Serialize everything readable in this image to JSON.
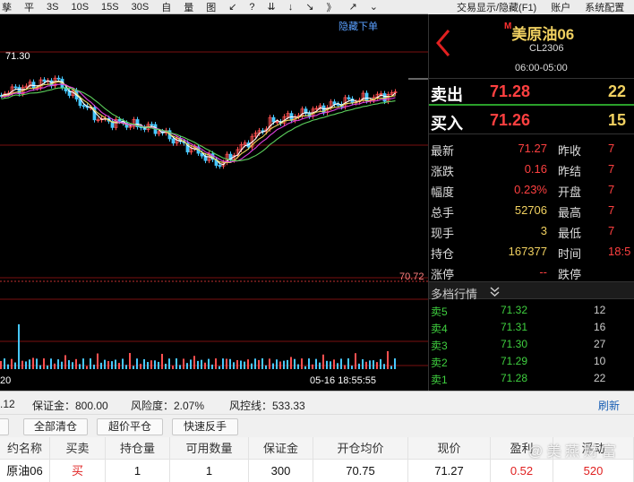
{
  "toolbar": {
    "items": [
      "孳",
      "平",
      "3S",
      "10S",
      "15S",
      "30S",
      "自",
      "量",
      "图",
      "↙",
      "?",
      "⇊",
      "↓",
      "↘",
      "》",
      "↗",
      "⌄"
    ]
  },
  "topright": {
    "items": [
      "交易显示/隐藏(F1)",
      "账户",
      "系统配置"
    ]
  },
  "chart": {
    "hide_order": "隐藏下单",
    "price_high": "71.30",
    "price_low": "70.72",
    "time_left": "20",
    "timestamp": "05-16 18:55:55",
    "colors": {
      "candle_up": "#ff5050",
      "candle_down": "#47c8ff",
      "ma_white": "#ffffff",
      "ma_yellow": "#e6d45a",
      "ma_magenta": "#e040e0",
      "ma_green": "#5cd05c",
      "grid_red": "#7a1010"
    }
  },
  "quote": {
    "name": "美原油06",
    "badge": "M",
    "code": "CL2306",
    "session": "06:00-05:00",
    "sell_label": "卖出",
    "sell_price": "71.28",
    "sell_qty": "22",
    "buy_label": "买入",
    "buy_price": "71.26",
    "buy_qty": "15",
    "stats": [
      {
        "l": "最新",
        "v": "71.27",
        "l2": "昨收",
        "v2": "7"
      },
      {
        "l": "涨跌",
        "v": "0.16",
        "l2": "昨结",
        "v2": "7"
      },
      {
        "l": "幅度",
        "v": "0.23%",
        "l2": "开盘",
        "v2": "7"
      },
      {
        "l": "总手",
        "v": "52706",
        "l2": "最高",
        "v2": "7"
      },
      {
        "l": "现手",
        "v": "3",
        "l2": "最低",
        "v2": "7"
      },
      {
        "l": "持仓",
        "v": "167377",
        "l2": "时间",
        "v2": "18:5"
      },
      {
        "l": "涨停",
        "v": "--",
        "l2": "跌停",
        "v2": ""
      }
    ],
    "depth_title": "多档行情",
    "depth_icon": "chevron-double-down",
    "depth": [
      {
        "l": "卖5",
        "p": "71.32",
        "q": "12"
      },
      {
        "l": "卖4",
        "p": "71.31",
        "q": "16"
      },
      {
        "l": "卖3",
        "p": "71.30",
        "q": "27"
      },
      {
        "l": "卖2",
        "p": "71.29",
        "q": "10"
      },
      {
        "l": "卖1",
        "p": "71.28",
        "q": "22"
      }
    ]
  },
  "status": {
    "lead": ".12",
    "margin": "保证金：800.00",
    "risk": "风险度：2.07%",
    "risk_line": "风控线：533.33",
    "refresh": "刷新"
  },
  "buttons": {
    "b0": "",
    "b1": "全部清仓",
    "b2": "超价平仓",
    "b3": "快速反手"
  },
  "table": {
    "headers": [
      "约名称",
      "买卖",
      "持仓量",
      "可用数量",
      "保证金",
      "开仓均价",
      "现价",
      "盈利",
      "浮动"
    ],
    "row": [
      "原油06",
      "买",
      "1",
      "1",
      "300",
      "70.75",
      "71.27",
      "0.52",
      "520"
    ],
    "watermark": "@ 美 燕 财 富"
  }
}
